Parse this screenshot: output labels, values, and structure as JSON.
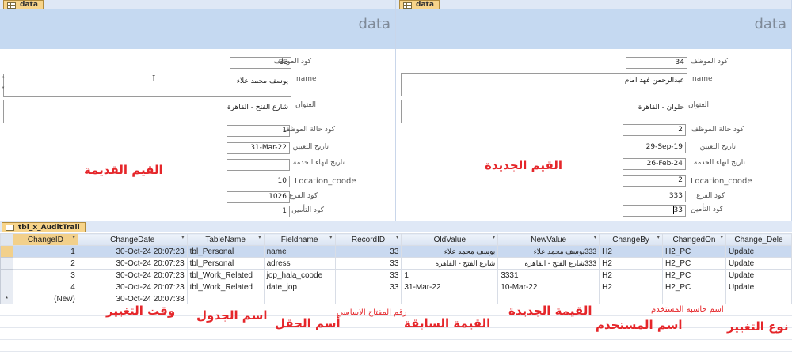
{
  "left_form": {
    "tab_label": "data",
    "header_title": "data",
    "labels": {
      "emp_code": "كود الموظف",
      "name": "name",
      "address": "العنوان",
      "status_code": "كود حالة الموظف",
      "hire_date": "تاريخ التعيين",
      "end_date": "تاريخ انهاء الخدمة",
      "location": "Location_coode",
      "branch": "كود الفرع",
      "insurance": "كود التأمين"
    },
    "values": {
      "emp_code": "33",
      "name": "يوسف محمد علاء",
      "address": "شارع الفتح - القاهرة",
      "status_code": "1",
      "hire_date": "31-Mar-22",
      "end_date": "",
      "location": "10",
      "branch": "1026",
      "insurance": "1"
    },
    "annotation": "القيم القديمة"
  },
  "right_form": {
    "tab_label": "data",
    "header_title": "data",
    "labels": {
      "emp_code": "كود الموظف",
      "name": "name",
      "address": "العنوان",
      "status_code": "كود حالة الموظف",
      "hire_date": "تاريخ التعيين",
      "end_date": "تاريخ انهاء الخدمة",
      "location": "Location_coode",
      "branch": "كود الفرع",
      "insurance": "كود التأمين"
    },
    "values": {
      "emp_code": "34",
      "name": "عبدالرحمن فهد امام",
      "address": "حلوان - القاهرة",
      "status_code": "2",
      "hire_date": "29-Sep-19",
      "end_date": "26-Feb-24",
      "location": "2",
      "branch": "333",
      "insurance": "33"
    },
    "annotation": "القيم الجديدة"
  },
  "audit_table": {
    "tab_label": "tbl_x_AuditTrail",
    "columns": [
      "ChangeID",
      "ChangeDate",
      "TableName",
      "Fieldname",
      "RecordID",
      "OldValue",
      "NewValue",
      "ChangeBy",
      "ChangedOn",
      "Change_Dele"
    ],
    "rows": [
      {
        "ChangeID": "1",
        "ChangeDate": "30-Oct-24 20:07:23",
        "TableName": "tbl_Personal",
        "Fieldname": "name",
        "RecordID": "33",
        "OldValue": "يوسف محمد علاء",
        "NewValue": "333يوسف محمد علاء",
        "ChangeBy": "H2",
        "ChangedOn": "H2_PC",
        "Change_Dele": "Update"
      },
      {
        "ChangeID": "2",
        "ChangeDate": "30-Oct-24 20:07:23",
        "TableName": "tbl_Personal",
        "Fieldname": "adress",
        "RecordID": "33",
        "OldValue": "شارع الفتح - القاهرة",
        "NewValue": "333شارع الفتح - القاهرة",
        "ChangeBy": "H2",
        "ChangedOn": "H2_PC",
        "Change_Dele": "Update"
      },
      {
        "ChangeID": "3",
        "ChangeDate": "30-Oct-24 20:07:23",
        "TableName": "tbl_Work_Related",
        "Fieldname": "jop_hala_coode",
        "RecordID": "33",
        "OldValue": "1",
        "NewValue": "3331",
        "ChangeBy": "H2",
        "ChangedOn": "H2_PC",
        "Change_Dele": "Update"
      },
      {
        "ChangeID": "4",
        "ChangeDate": "30-Oct-24 20:07:23",
        "TableName": "tbl_Work_Related",
        "Fieldname": "date_jop",
        "RecordID": "33",
        "OldValue": "31-Mar-22",
        "NewValue": "10-Mar-22",
        "ChangeBy": "H2",
        "ChangedOn": "H2_PC",
        "Change_Dele": "Update"
      }
    ],
    "new_row": {
      "ChangeID": "(New)",
      "ChangeDate": "30-Oct-24 20:07:38"
    },
    "new_row_marker": "*"
  },
  "annotations": {
    "change_time": "وقت التغيير",
    "table_name": "اسم الجدول",
    "field_name": "أسم الحقل",
    "primary_key": "رقم المفتاح الاساسي",
    "old_value": "القيمة السابقة",
    "new_value": "القيمة الجديدة",
    "user_name": "اسم المستخدم",
    "computer_name": "اسم حاسبة المستخدم",
    "change_type": "نوع التغيير"
  },
  "colors": {
    "annotation": "#e5262a",
    "form_header": "#c5d9f1",
    "active_row": "#c9d9f0"
  }
}
